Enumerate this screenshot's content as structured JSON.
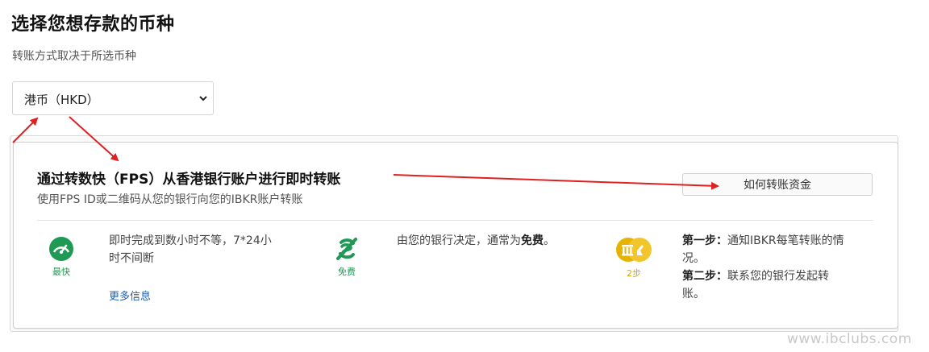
{
  "page": {
    "heading": "选择您想存款的币种",
    "subheading": "转账方式取决于所选币种"
  },
  "currency_select": {
    "selected": "港币（HKD）"
  },
  "card": {
    "title": "通过转数快（FPS）从香港银行账户进行即时转账",
    "subtitle": "使用FPS ID或二维码从您的银行向您的IBKR账户转账",
    "howto_button": "如何转账资金"
  },
  "features": {
    "speed": {
      "icon": "speedometer-icon",
      "label": "最快",
      "color": "#1e9a55",
      "text_line1": "即时完成到数小时不等，7*24小",
      "text_line2": "时不间断",
      "more_link": "更多信息"
    },
    "fee": {
      "icon": "no-fee-icon",
      "label": "免费",
      "color": "#1e9a55",
      "text_prefix": "由您的银行决定，通常为",
      "text_bold": "免费",
      "text_suffix": "。"
    },
    "steps": {
      "icon": "steps-icon",
      "label": "2步",
      "color": "#e0b000",
      "step1_bold": "第一步：",
      "step1_line1": "通知IBKR每笔转账的情",
      "step1_line2": "况。",
      "step2_bold": "第二步：",
      "step2_line1": "联系您的银行发起转",
      "step2_line2": "账。"
    }
  },
  "annotations": {
    "arrow_color": "#e02020"
  },
  "watermark": "www.ibclubs.com"
}
